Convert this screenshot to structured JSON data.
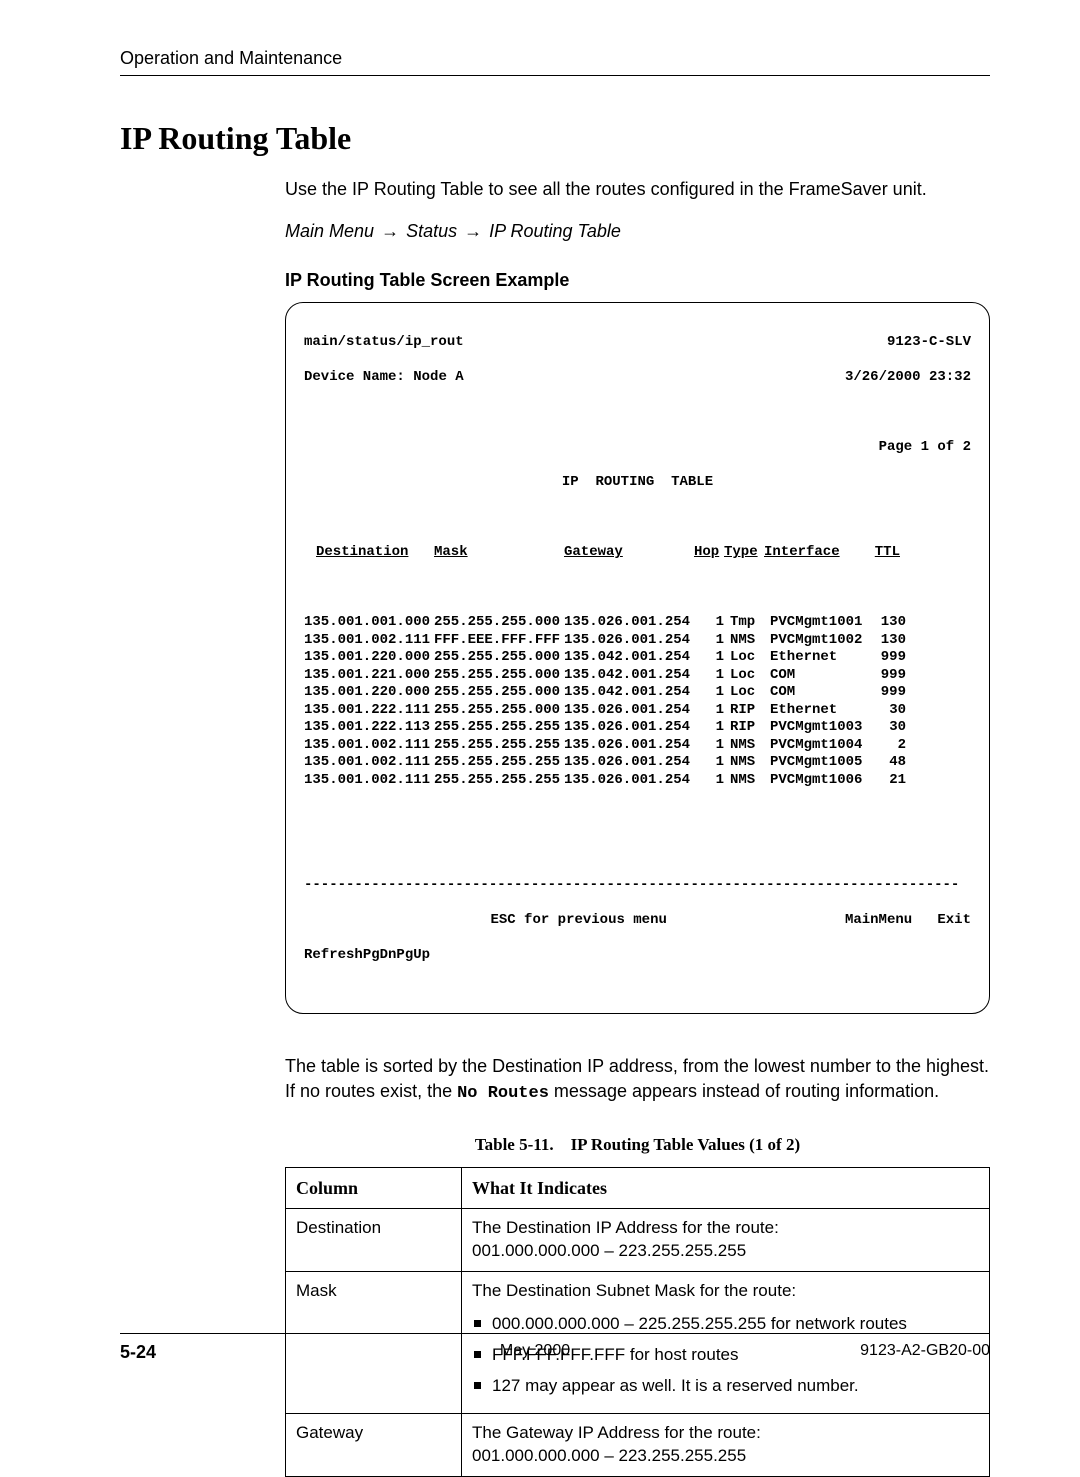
{
  "header": {
    "running_head": "Operation and Maintenance"
  },
  "title": "IP Routing Table",
  "intro": "Use the IP Routing Table to see all the routes configured in the FrameSaver unit.",
  "breadcrumb": {
    "a": "Main Menu",
    "b": "Status",
    "c": "IP Routing Table"
  },
  "screen_caption": "IP Routing Table Screen Example",
  "terminal": {
    "path": "main/status/ip_rout",
    "model": "9123-C-SLV",
    "device_label": "Device Name:",
    "device_name": "Node A",
    "timestamp": "3/26/2000 23:32",
    "page": "Page 1 of 2",
    "title": "IP  ROUTING  TABLE",
    "headers": {
      "dest": "Destination",
      "mask": "Mask",
      "gw": "Gateway",
      "hop": "Hop",
      "type": "Type",
      "if": "Interface",
      "ttl": "TTL"
    },
    "rows": [
      {
        "dest": "135.001.001.000",
        "mask": "255.255.255.000",
        "gw": "135.026.001.254",
        "hop": "1",
        "type": "Tmp",
        "if": "PVCMgmt1001",
        "ttl": "130"
      },
      {
        "dest": "135.001.002.111",
        "mask": "FFF.EEE.FFF.FFF",
        "gw": "135.026.001.254",
        "hop": "1",
        "type": "NMS",
        "if": "PVCMgmt1002",
        "ttl": "130"
      },
      {
        "dest": "135.001.220.000",
        "mask": "255.255.255.000",
        "gw": "135.042.001.254",
        "hop": "1",
        "type": "Loc",
        "if": "Ethernet",
        "ttl": "999"
      },
      {
        "dest": "135.001.221.000",
        "mask": "255.255.255.000",
        "gw": "135.042.001.254",
        "hop": "1",
        "type": "Loc",
        "if": "COM",
        "ttl": "999"
      },
      {
        "dest": "135.001.220.000",
        "mask": "255.255.255.000",
        "gw": "135.042.001.254",
        "hop": "1",
        "type": "Loc",
        "if": "COM",
        "ttl": "999"
      },
      {
        "dest": "135.001.222.111",
        "mask": "255.255.255.000",
        "gw": "135.026.001.254",
        "hop": "1",
        "type": "RIP",
        "if": "Ethernet",
        "ttl": "30"
      },
      {
        "dest": "135.001.222.113",
        "mask": "255.255.255.255",
        "gw": "135.026.001.254",
        "hop": "1",
        "type": "RIP",
        "if": "PVCMgmt1003",
        "ttl": "30"
      },
      {
        "dest": "135.001.002.111",
        "mask": "255.255.255.255",
        "gw": "135.026.001.254",
        "hop": "1",
        "type": "NMS",
        "if": "PVCMgmt1004",
        "ttl": "2"
      },
      {
        "dest": "135.001.002.111",
        "mask": "255.255.255.255",
        "gw": "135.026.001.254",
        "hop": "1",
        "type": "NMS",
        "if": "PVCMgmt1005",
        "ttl": "48"
      },
      {
        "dest": "135.001.002.111",
        "mask": "255.255.255.255",
        "gw": "135.026.001.254",
        "hop": "1",
        "type": "NMS",
        "if": "PVCMgmt1006",
        "ttl": "21"
      }
    ],
    "rule": "------------------------------------------------------------------------------",
    "esc": "ESC for previous menu",
    "mainmenu": "MainMenu",
    "exit": "Exit",
    "refresh": "Refresh",
    "pgdn": "PgDn",
    "pgup": "PgUp"
  },
  "post_para_a": "The table is sorted by the Destination IP address, from the lowest number to the highest. If no routes exist, the ",
  "post_para_code": "No Routes",
  "post_para_b": " message appears instead of routing information.",
  "table_caption": "Table 5-11. IP Routing Table Values (1 of 2)",
  "values_table": {
    "headers": {
      "col": "Column",
      "what": "What It Indicates"
    },
    "rows": [
      {
        "col": "Destination",
        "lines": [
          "The Destination IP Address for the route:",
          "001.000.000.000 – 223.255.255.255"
        ],
        "bullets": []
      },
      {
        "col": "Mask",
        "lines": [
          "The Destination Subnet Mask for the route:"
        ],
        "bullets": [
          "000.000.000.000 – 225.255.255.255  for network routes",
          "FFF.FFF.FFF.FFF for host routes",
          "127 may appear as well. It is a reserved number."
        ]
      },
      {
        "col": "Gateway",
        "lines": [
          "The Gateway IP Address for the route:",
          "001.000.000.000 – 223.255.255.255"
        ],
        "bullets": []
      }
    ]
  },
  "footer": {
    "page": "5-24",
    "date": "May 2000",
    "docid": "9123-A2-GB20-00"
  }
}
